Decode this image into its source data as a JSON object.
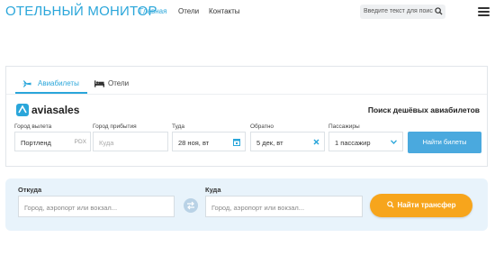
{
  "header": {
    "logo": "ОТЕЛЬНЫЙ МОНИТОР",
    "nav": [
      "Главная",
      "Отели",
      "Контакты"
    ],
    "search_placeholder": "Введите текст для поис"
  },
  "flights": {
    "tabs": [
      "Авиабилеты",
      "Отели"
    ],
    "brand": "aviasales",
    "slogan": "Поиск дешёвых авиабилетов",
    "labels": {
      "from": "Город вылета",
      "to": "Город прибытия",
      "depart": "Туда",
      "return": "Обратно",
      "passengers": "Пассажиры"
    },
    "values": {
      "from": "Портленд",
      "from_code": "PDX",
      "to_placeholder": "Куда",
      "depart": "28 ноя, вт",
      "return": "5 дек, вт",
      "passengers": "1 пассажир"
    },
    "submit": "Найти билеты"
  },
  "transfer": {
    "from_label": "Откуда",
    "to_label": "Куда",
    "from_placeholder": "Город, аэропорт или вокзал...",
    "to_placeholder": "Город, аэропорт или вокзал...",
    "submit": "Найти трансфер"
  },
  "colors": {
    "accent": "#2aa6da",
    "button_blue": "#4aa9de",
    "button_orange": "#f7a51c",
    "transfer_bg": "#e8f3fb"
  }
}
